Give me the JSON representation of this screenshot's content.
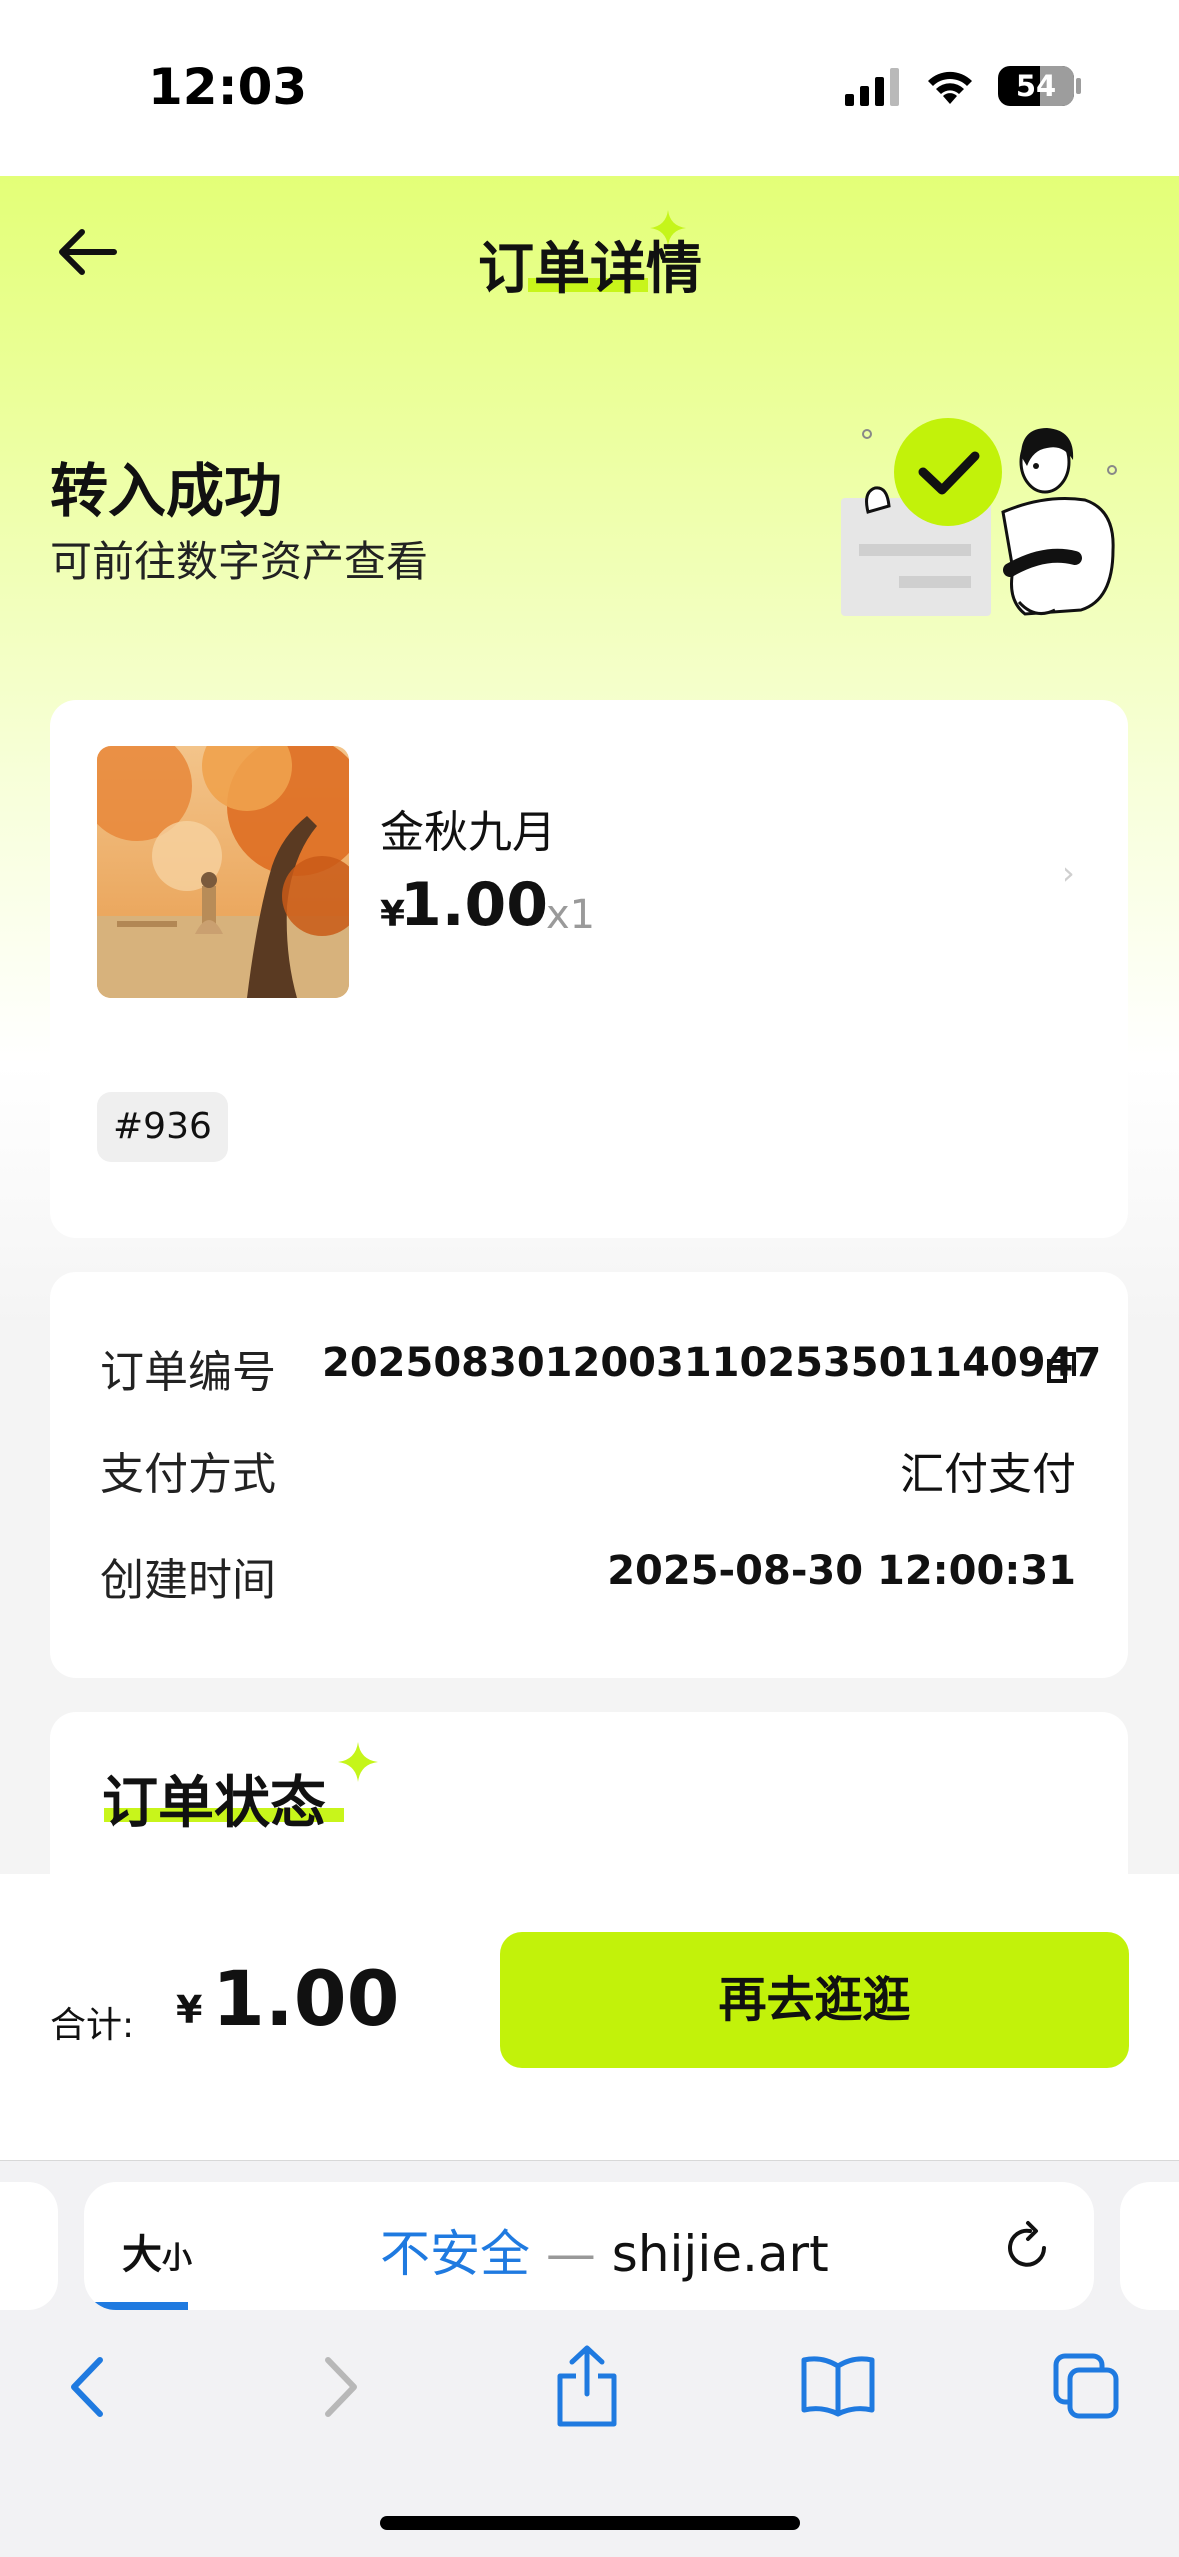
{
  "status_bar": {
    "time": "12:03",
    "battery": "54"
  },
  "header": {
    "title": "订单详情"
  },
  "banner": {
    "title": "转入成功",
    "subtitle": "可前往数字资产查看"
  },
  "product": {
    "name": "金秋九月",
    "currency": "¥",
    "price": "1.00",
    "quantity": "x1",
    "tag": "#936"
  },
  "order_info": {
    "rows": [
      {
        "label": "订单编号",
        "value": "20250830120031102535011409​47"
      },
      {
        "label": "支付方式",
        "value": "汇付支付"
      },
      {
        "label": "创建时间",
        "value": "2025-08-30 12:00:31"
      }
    ]
  },
  "order_status": {
    "title": "订单状态"
  },
  "footer": {
    "total_label": "合计:",
    "currency": "¥",
    "total": "1.00",
    "button": "再去逛逛"
  },
  "browser": {
    "text_size": "大",
    "text_size_small": "小",
    "insecure": "不安全",
    "separator": " — ",
    "domain": "shijie.art"
  },
  "colors": {
    "accent": "#c2f20a",
    "link_blue": "#1f7ae0"
  }
}
